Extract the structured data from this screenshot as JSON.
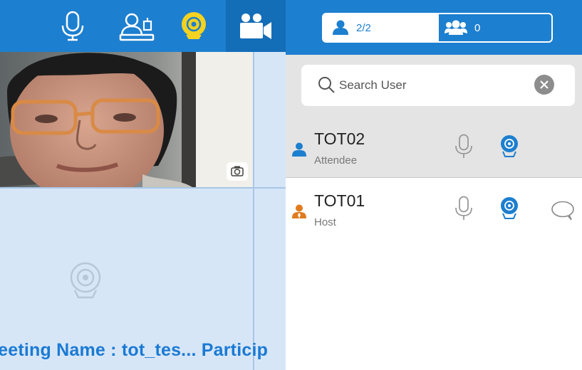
{
  "toolbar": {
    "items": [
      {
        "name": "microphone",
        "active": false
      },
      {
        "name": "host-control",
        "active": false
      },
      {
        "name": "camera",
        "active": true
      },
      {
        "name": "video-panel",
        "active": true
      }
    ]
  },
  "meeting": {
    "ticker_text": "leeting Name :  tot_tes... Particip"
  },
  "participants": {
    "tabs": [
      {
        "label": "2/2",
        "icon": "user-icon",
        "selected": true
      },
      {
        "label": "0",
        "icon": "group-icon",
        "selected": false
      }
    ],
    "search": {
      "placeholder": "Search User",
      "value": ""
    },
    "users": [
      {
        "name": "TOT02",
        "role": "Attendee",
        "role_color": "#1d7fcf",
        "has_chat": false
      },
      {
        "name": "TOT01",
        "role": "Host",
        "role_color": "#e07b1f",
        "has_chat": true
      }
    ]
  },
  "colors": {
    "header_blue": "#1d7fcf",
    "video_area_bg": "#d7e6f7",
    "camera_active_yellow": "#f4d21f",
    "ticker_blue": "#1a7ad4"
  }
}
